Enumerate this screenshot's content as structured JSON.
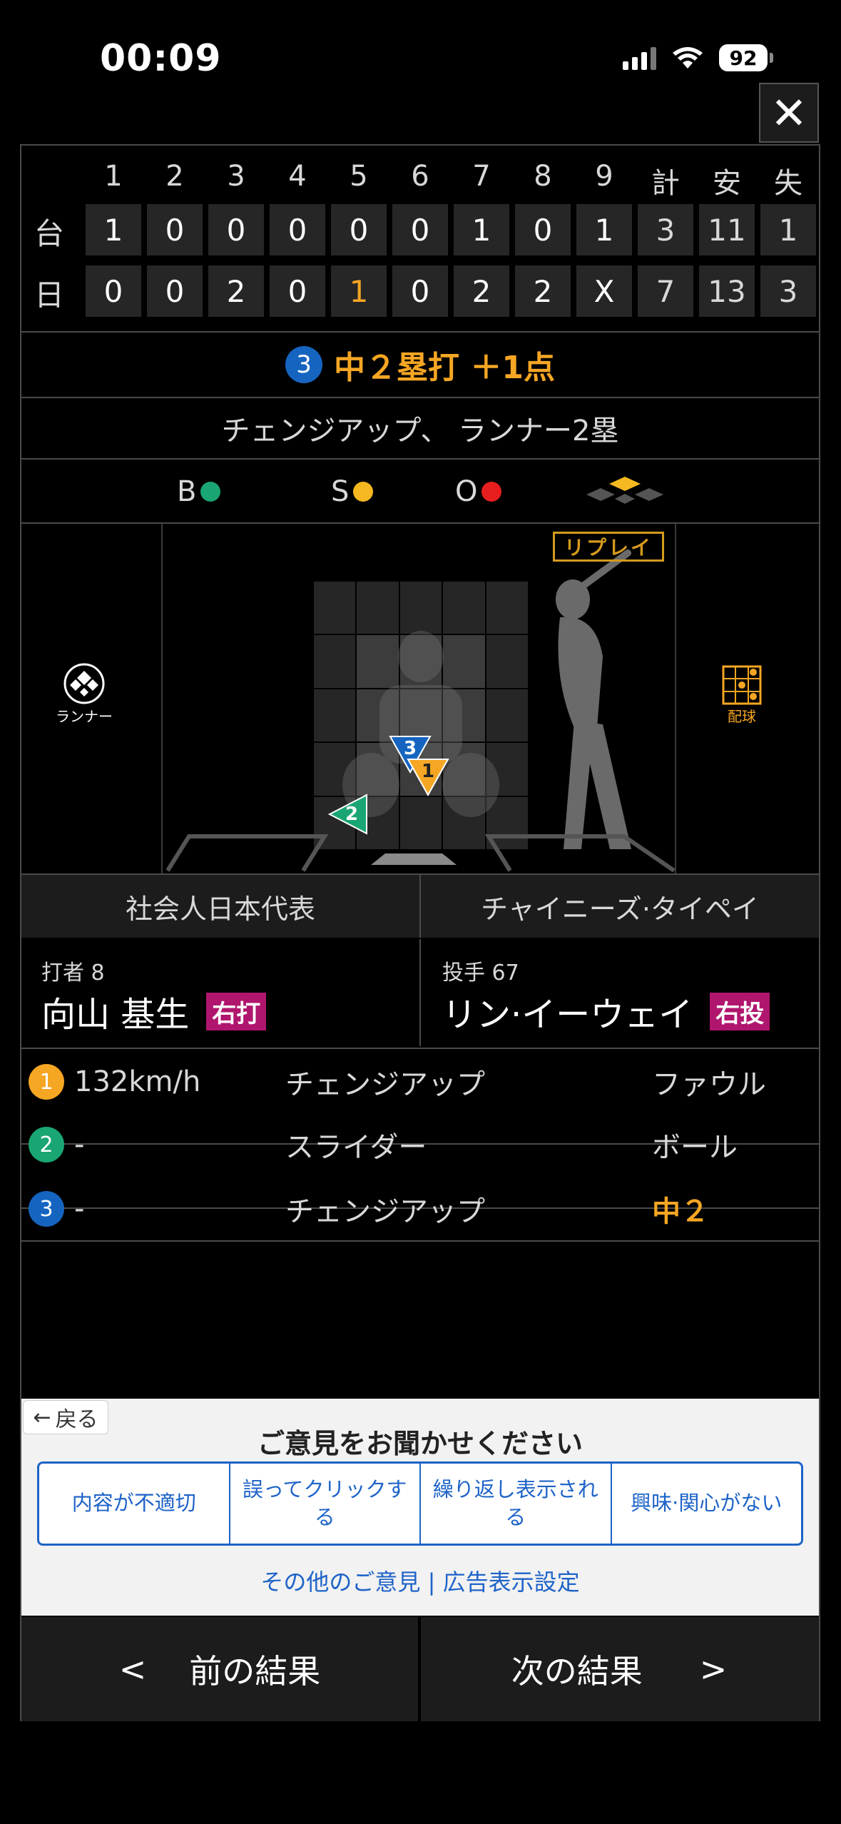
{
  "status_bar": {
    "time": "00:09",
    "battery": "92"
  },
  "close_label": "✕",
  "scoreboard": {
    "innings": [
      "1",
      "2",
      "3",
      "4",
      "5",
      "6",
      "7",
      "8",
      "9",
      "計",
      "安",
      "失"
    ],
    "teams": [
      {
        "name": "台",
        "cells": [
          "1",
          "0",
          "0",
          "0",
          "0",
          "0",
          "1",
          "0",
          "1",
          "3",
          "11",
          "1"
        ]
      },
      {
        "name": "日",
        "cells": [
          "0",
          "0",
          "2",
          "0",
          "1",
          "0",
          "2",
          "2",
          "X",
          "7",
          "13",
          "3"
        ]
      }
    ],
    "highlight_color": "#f5a623"
  },
  "play": {
    "pitch_number": "3",
    "result": "中２塁打 ＋1点"
  },
  "pitch_description": "チェンジアップ、 ランナー2塁",
  "count": {
    "ball_label": "B",
    "strike_label": "S",
    "out_label": "O",
    "ball_color": "#1aa672",
    "strike_color": "#f5b820",
    "out_color": "#e81e1e"
  },
  "zone": {
    "replay_label": "リプレイ",
    "runner_label": "ランナー",
    "pitching_label": "配球",
    "marks": [
      {
        "number": "3",
        "color": "#1565c0"
      },
      {
        "number": "1",
        "color": "#f5a623"
      },
      {
        "number": "2",
        "color": "#1aa672"
      }
    ]
  },
  "teams": {
    "home": "社会人日本代表",
    "away": "チャイニーズ·タイペイ"
  },
  "batter": {
    "role": "打者 8",
    "name": "向山 基生",
    "hand": "右打"
  },
  "pitcher": {
    "role": "投手 67",
    "name": "リン·イーウェイ",
    "hand": "右投"
  },
  "pitches": [
    {
      "number": "1",
      "color": "#f5a623",
      "speed": "132km/h",
      "type": "チェンジアップ",
      "result": "ファウル"
    },
    {
      "number": "2",
      "color": "#1aa672",
      "speed": "-",
      "type": "スライダー",
      "result": "ボール"
    },
    {
      "number": "3",
      "color": "#1565c0",
      "speed": "-",
      "type": "チェンジアップ",
      "result": "中２"
    }
  ],
  "feedback": {
    "back_label": "戻る",
    "title": "ご意見をお聞かせください",
    "options": [
      "内容が不適切",
      "誤ってクリックする",
      "繰り返し表示される",
      "興味·関心がない"
    ],
    "other_link": "その他のご意見",
    "separator": "|",
    "ad_settings_link": "広告表示設定"
  },
  "navigation": {
    "prev_label": "前の結果",
    "next_label": "次の結果",
    "prev_arrow": "<",
    "next_arrow": ">"
  }
}
